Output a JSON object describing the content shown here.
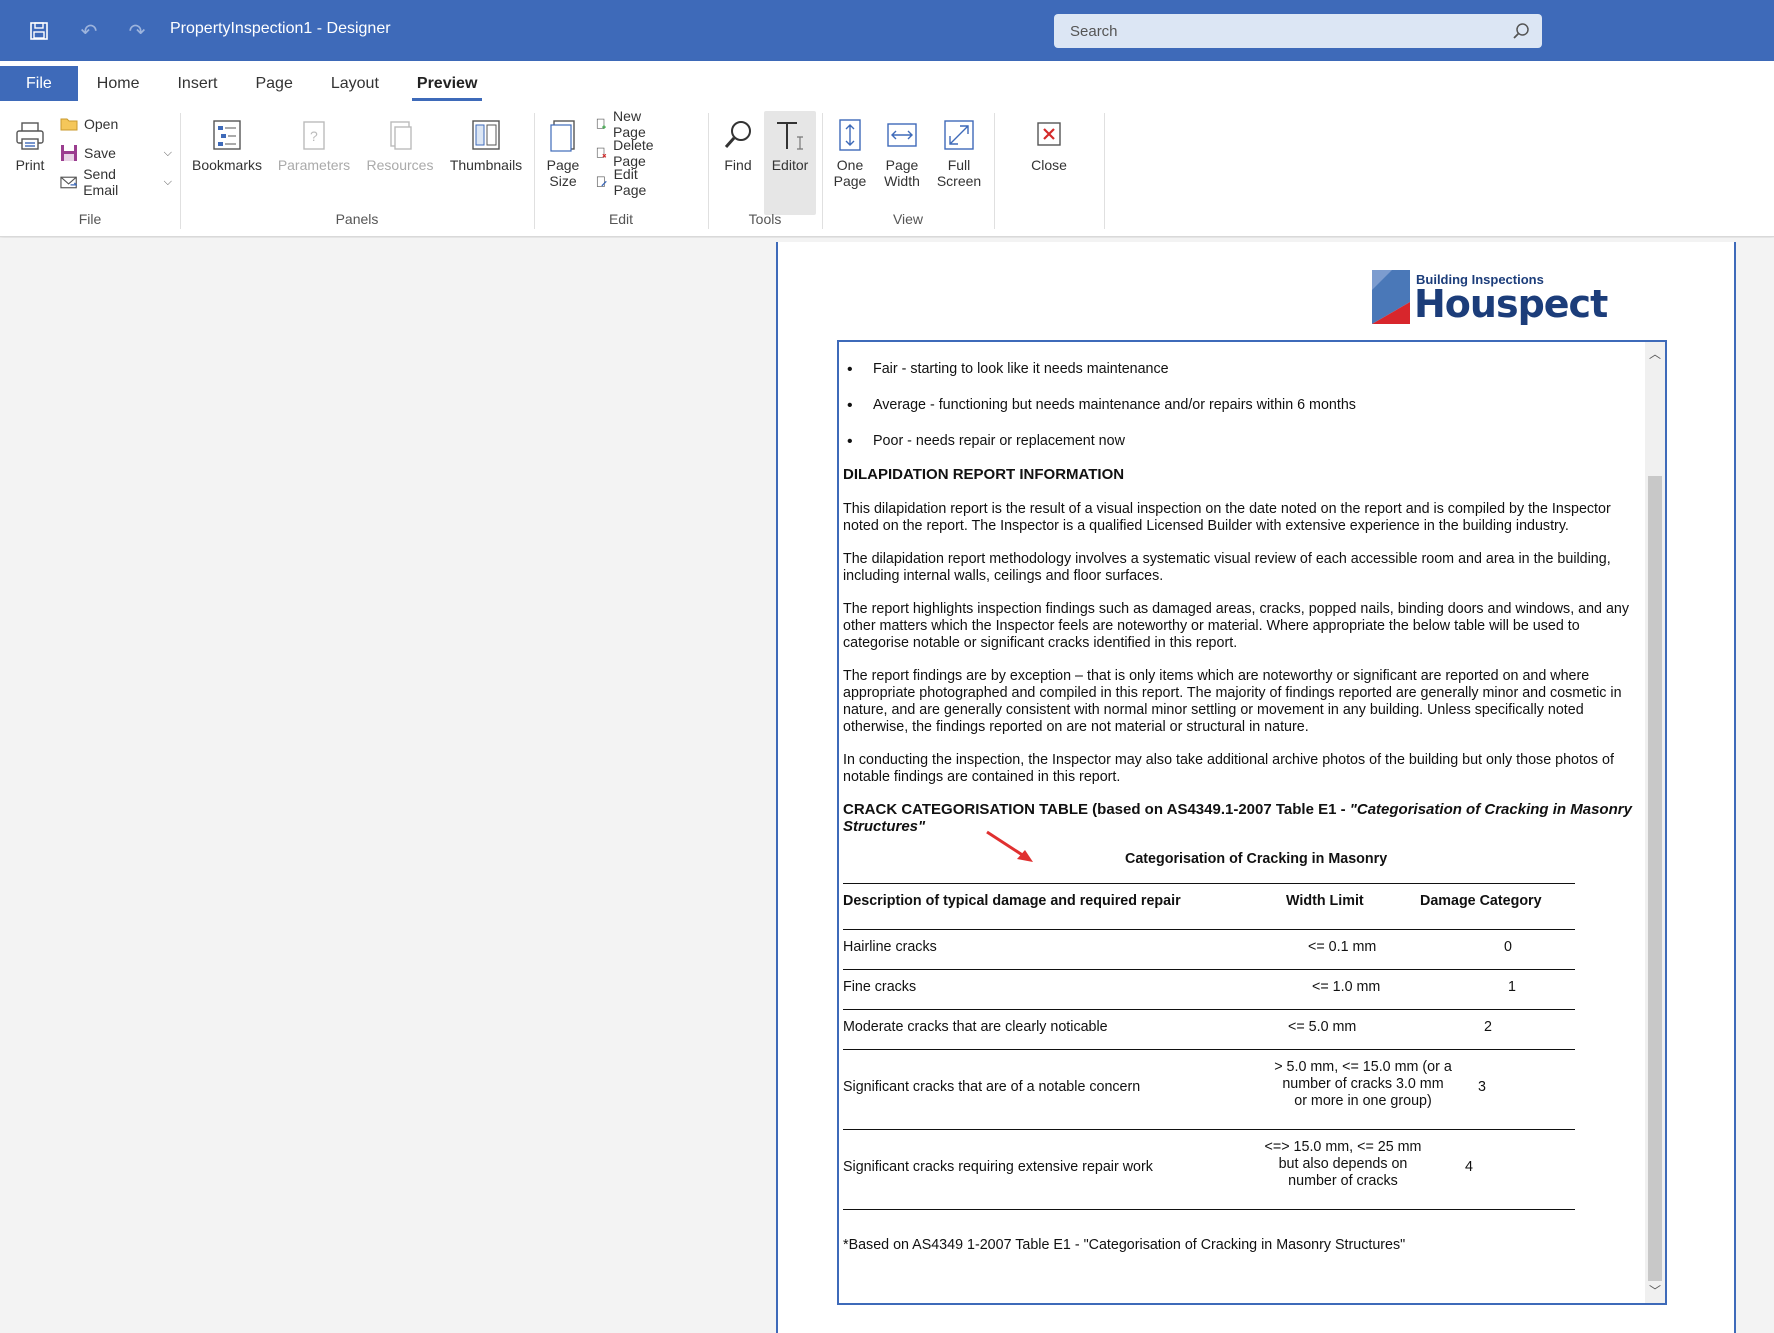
{
  "window": {
    "title": "PropertyInspection1 - Designer"
  },
  "search": {
    "placeholder": "Search"
  },
  "tabs": [
    {
      "label": "File"
    },
    {
      "label": "Home"
    },
    {
      "label": "Insert"
    },
    {
      "label": "Page"
    },
    {
      "label": "Layout"
    },
    {
      "label": "Preview"
    }
  ],
  "ribbon": {
    "file_group": {
      "label": "File",
      "print": "Print",
      "open": "Open",
      "save": "Save",
      "send_email": "Send Email"
    },
    "panels_group": {
      "label": "Panels",
      "bookmarks": "Bookmarks",
      "parameters": "Parameters",
      "resources": "Resources",
      "thumbnails": "Thumbnails"
    },
    "edit_group": {
      "label": "Edit",
      "page_size_1": "Page",
      "page_size_2": "Size",
      "new_page": "New Page",
      "delete_page": "Delete Page",
      "edit_page": "Edit Page"
    },
    "tools_group": {
      "label": "Tools",
      "find": "Find",
      "editor": "Editor"
    },
    "view_group": {
      "label": "View",
      "one_page_1": "One",
      "one_page_2": "Page",
      "page_width_1": "Page",
      "page_width_2": "Width",
      "full_screen_1": "Full",
      "full_screen_2": "Screen"
    },
    "close": "Close"
  },
  "document": {
    "logo_sub": "Building Inspections",
    "logo_main": "Houspect",
    "bullets": [
      "Fair - starting to look like it needs maintenance",
      "Average - functioning but needs maintenance and/or repairs within 6 months",
      "Poor - needs repair or replacement now"
    ],
    "heading1": "DILAPIDATION REPORT INFORMATION",
    "paragraphs": [
      "This dilapidation report is the result of a visual inspection on the date noted on the report and is compiled by the Inspector noted on the report. The Inspector is a qualified Licensed Builder with extensive experience in the building industry.",
      "The dilapidation report methodology involves a systematic visual review of each accessible room and area in the building, including internal walls, ceilings and floor surfaces.",
      "The report highlights inspection findings such as damaged areas, cracks, popped nails, binding doors and windows, and any other matters which the Inspector feels are noteworthy or material. Where appropriate the below table will be used to categorise notable or significant cracks identified in this report.",
      "The report findings are by exception – that is only items which are noteworthy or significant are reported on and where appropriate photographed and compiled in this report. The majority of findings reported are generally minor and cosmetic in nature, and are generally consistent with normal minor settling or movement in any building. Unless specifically noted otherwise, the findings reported on are not material or structural in nature.",
      "In conducting the inspection, the Inspector may also take additional archive photos of the building but only those photos of notable findings are contained in this report."
    ],
    "heading2_plain": "CRACK CATEGORISATION TABLE (based on AS4349.1-2007 Table E1 - ",
    "heading2_italic": "\"Categorisation of Cracking in Masonry Structures\"",
    "table": {
      "title": "Categorisation of Cracking in Masonry",
      "headers": [
        "Description of typical damage and required repair",
        "Width Limit",
        "Damage Category"
      ],
      "rows": [
        {
          "desc": "Hairline cracks",
          "width": [
            "<= 0.1 mm"
          ],
          "cat": "0"
        },
        {
          "desc": "Fine cracks",
          "width": [
            "<= 1.0 mm"
          ],
          "cat": "1"
        },
        {
          "desc": "Moderate cracks that are clearly noticable",
          "width": [
            "<= 5.0 mm"
          ],
          "cat": "2"
        },
        {
          "desc": "Significant cracks that are of a notable concern",
          "width": [
            "> 5.0 mm, <= 15.0 mm (or a",
            "number of cracks 3.0 mm",
            "or more in one group)"
          ],
          "cat": "3"
        },
        {
          "desc": "Significant cracks requiring extensive repair work",
          "width": [
            "<=> 15.0 mm, <= 25 mm",
            "but also depends on",
            "number of cracks"
          ],
          "cat": "4"
        }
      ]
    },
    "footnote": "*Based on AS4349 1-2007 Table E1 - \"Categorisation of Cracking in Masonry Structures\""
  }
}
